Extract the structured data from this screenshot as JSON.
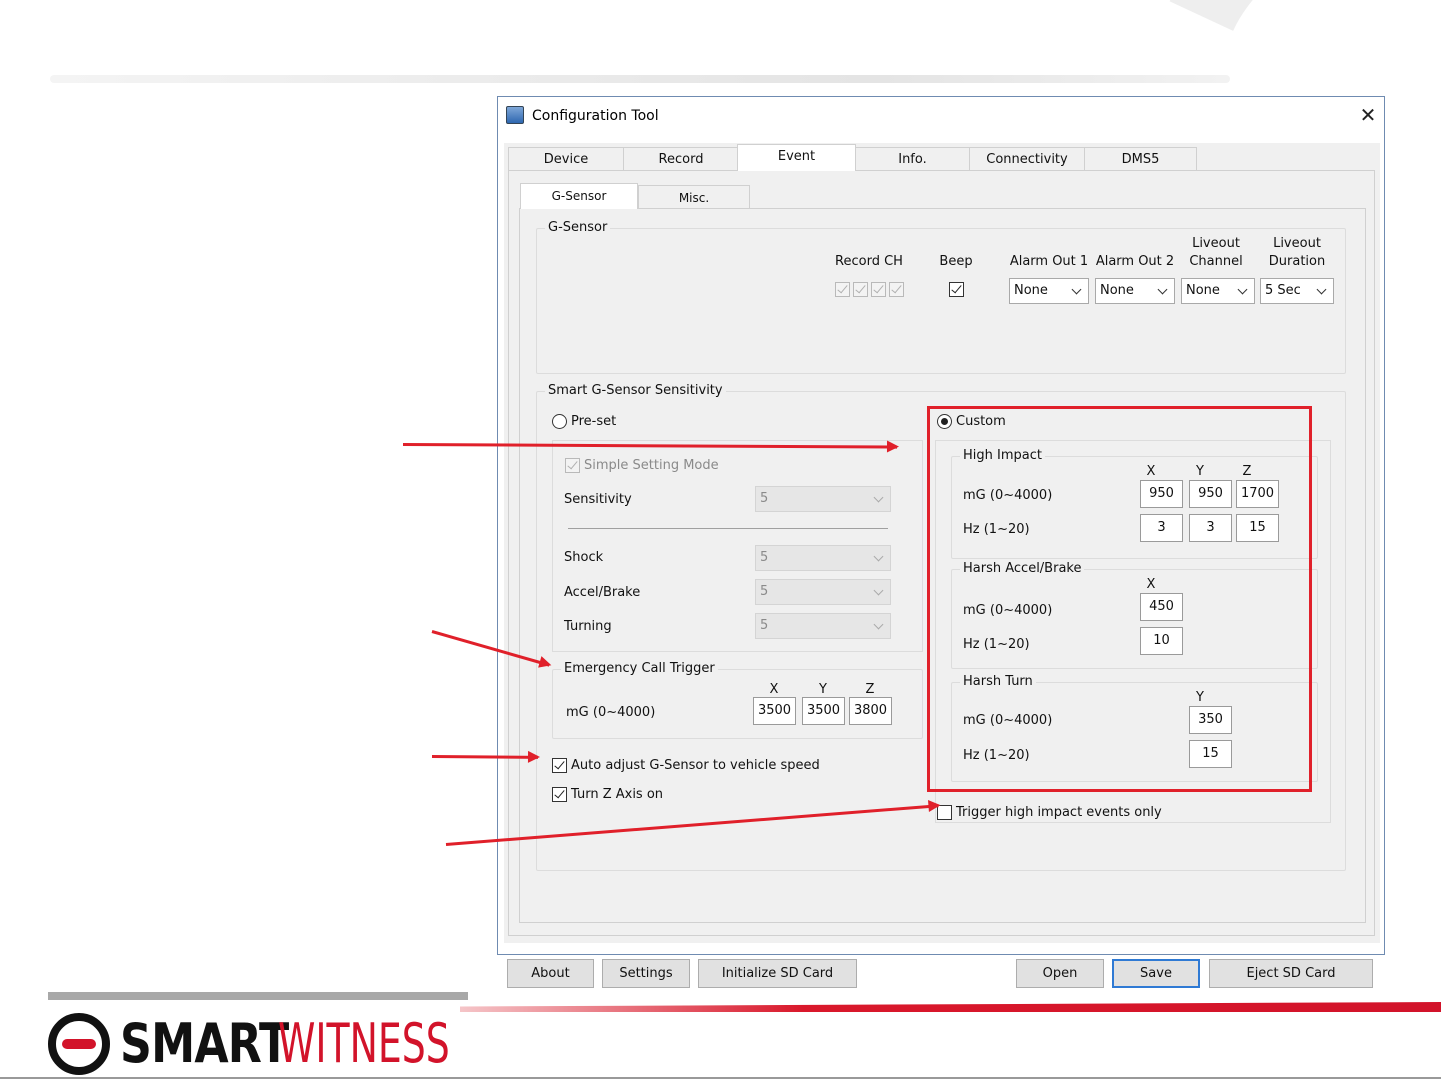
{
  "window": {
    "title": "Configuration Tool",
    "close_glyph": "✕"
  },
  "tabs": [
    "Device",
    "Record",
    "Event",
    "Info.",
    "Connectivity",
    "DMS5"
  ],
  "active_tab": "Event",
  "subtabs": [
    "G-Sensor",
    "Misc."
  ],
  "active_subtab": "G-Sensor",
  "gsensor_group": {
    "label": "G-Sensor",
    "record_ch_label": "Record CH",
    "beep_label": "Beep",
    "alarm_out1_label": "Alarm Out 1",
    "alarm_out2_label": "Alarm Out 2",
    "liveout_channel_label_1": "Liveout",
    "liveout_channel_label_2": "Channel",
    "liveout_duration_label_1": "Liveout",
    "liveout_duration_label_2": "Duration",
    "alarm_out1_value": "None",
    "alarm_out2_value": "None",
    "liveout_channel_value": "None",
    "liveout_duration_value": "5 Sec",
    "record_ch_checked": [
      true,
      true,
      true,
      true
    ],
    "beep_checked": true
  },
  "sensitivity_group": {
    "label": "Smart G-Sensor Sensitivity",
    "preset_label": "Pre-set",
    "simple_setting_label": "Simple Setting Mode",
    "sensitivity_label": "Sensitivity",
    "sensitivity_value": "5",
    "shock_label": "Shock",
    "shock_value": "5",
    "accel_label": "Accel/Brake",
    "accel_value": "5",
    "turning_label": "Turning",
    "turning_value": "5",
    "emergency": {
      "label": "Emergency Call Trigger",
      "row_label": "mG (0~4000)",
      "x_header": "X",
      "y_header": "Y",
      "z_header": "Z",
      "x": "3500",
      "y": "3500",
      "z": "3800"
    },
    "auto_adjust_label": "Auto adjust G-Sensor to vehicle speed",
    "turn_z_label": "Turn Z Axis on",
    "custom_label": "Custom",
    "high_impact": {
      "label": "High Impact",
      "x_header": "X",
      "y_header": "Y",
      "z_header": "Z",
      "mg_label": "mG (0~4000)",
      "hz_label": "Hz (1~20)",
      "mg_x": "950",
      "mg_y": "950",
      "mg_z": "1700",
      "hz_x": "3",
      "hz_y": "3",
      "hz_z": "15"
    },
    "harsh_accel": {
      "label": "Harsh Accel/Brake",
      "x_header": "X",
      "mg_label": "mG (0~4000)",
      "hz_label": "Hz (1~20)",
      "mg_x": "450",
      "hz_x": "10"
    },
    "harsh_turn": {
      "label": "Harsh Turn",
      "y_header": "Y",
      "mg_label": "mG (0~4000)",
      "hz_label": "Hz (1~20)",
      "mg_y": "350",
      "hz_y": "15"
    },
    "trigger_high_label": "Trigger high impact events only"
  },
  "buttons": {
    "about": "About",
    "settings": "Settings",
    "init_sd": "Initialize SD Card",
    "open": "Open",
    "save": "Save",
    "eject_sd": "Eject SD Card"
  },
  "brand": {
    "smart": "SMART",
    "witness": "WITNESS",
    "accent": "#d2132a",
    "highlight": "#e0202a"
  }
}
